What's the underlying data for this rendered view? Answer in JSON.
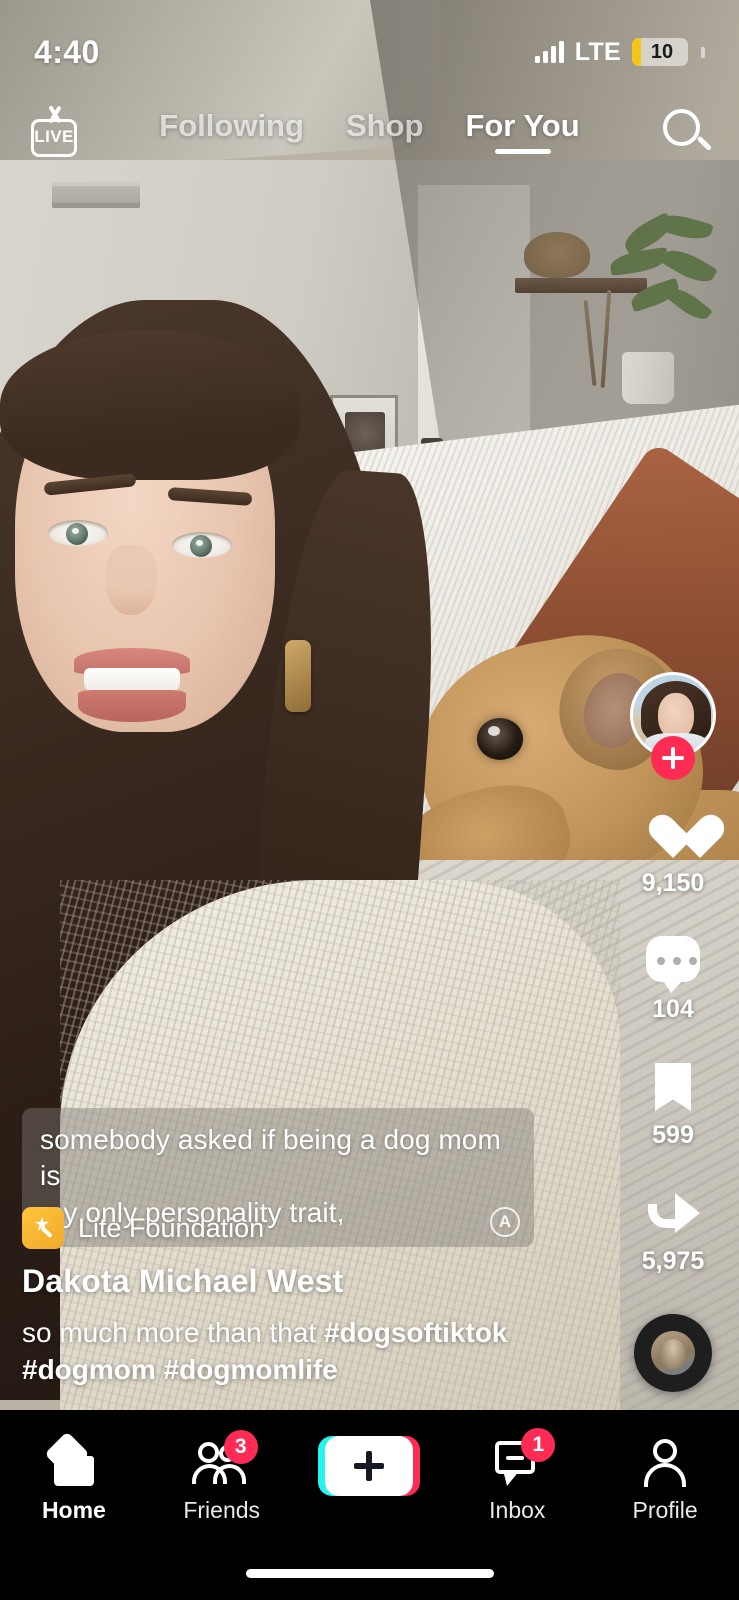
{
  "status_bar": {
    "time": "4:40",
    "network": "LTE",
    "battery_level": "10",
    "signal_icon": "cellular-signal-icon",
    "battery_icon": "battery-low-power-icon"
  },
  "top_nav": {
    "live_label": "LIVE",
    "live_icon": "live-tv-icon",
    "search_icon": "search-icon",
    "tabs": [
      {
        "label": "Following",
        "active": false
      },
      {
        "label": "Shop",
        "active": false
      },
      {
        "label": "For You",
        "active": true
      }
    ]
  },
  "action_rail": {
    "avatar_name": "creator-avatar",
    "follow_icon": "plus-icon",
    "follow_color": "#fe2c55",
    "actions": [
      {
        "icon": "heart-icon",
        "count": "9,150"
      },
      {
        "icon": "comment-bubble-icon",
        "count": "104"
      },
      {
        "icon": "bookmark-icon",
        "count": "599"
      },
      {
        "icon": "share-arrow-icon",
        "count": "5,975"
      }
    ],
    "music_disc_icon": "music-disc-icon"
  },
  "subtitles": {
    "line1": "somebody asked if being a dog mom is",
    "line2": "my only personality trait,",
    "auto_caption_badge": "A"
  },
  "video_meta": {
    "effect_icon": "magic-wand-icon",
    "effect_label": "Lite Foundation",
    "username": "Dakota Michael West",
    "caption_text": "so much more than that ",
    "caption_tags_line1": "#dogsoftiktok",
    "caption_tags_line2": "#dogmom #dogmomlife"
  },
  "tab_bar": {
    "items": [
      {
        "label": "Home",
        "icon": "home-icon",
        "badge": "",
        "active": true
      },
      {
        "label": "Friends",
        "icon": "friends-icon",
        "badge": "3",
        "active": false
      },
      {
        "label": "",
        "icon": "create-plus-icon",
        "badge": "",
        "active": false
      },
      {
        "label": "Inbox",
        "icon": "inbox-icon",
        "badge": "1",
        "active": false
      },
      {
        "label": "Profile",
        "icon": "profile-icon",
        "badge": "",
        "active": false
      }
    ]
  },
  "colors": {
    "accent_pink": "#fe2c55",
    "accent_cyan": "#25f4ee",
    "badge_yellow": "#f5c518"
  }
}
